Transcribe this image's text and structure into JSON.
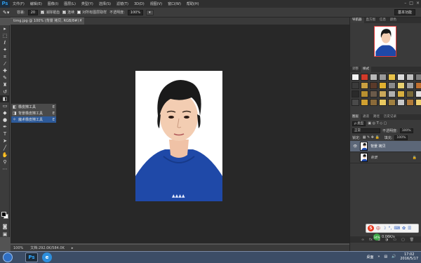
{
  "menubar": {
    "logo": "Ps",
    "items": [
      "文件(F)",
      "编辑(E)",
      "图像(I)",
      "图层(L)",
      "类型(Y)",
      "选择(S)",
      "滤镜(T)",
      "3D(D)",
      "视图(V)",
      "窗口(W)",
      "帮助(H)"
    ],
    "window_buttons": [
      "–",
      "□",
      "×"
    ]
  },
  "options": {
    "tool_icon": "brush-icon",
    "tolerance_label": "容差:",
    "tolerance_value": "20",
    "antialias_label": "消除锯齿",
    "contiguous_label": "连续",
    "all_layers_label": "对所有图层取样",
    "opacity_label": "不透明度:",
    "opacity_value": "100%",
    "workspace": "基本功能"
  },
  "document": {
    "tab_title": "timg.jpg @ 100% (背景 拷贝, RGB/8#) *",
    "close": "×"
  },
  "flyout": {
    "items": [
      {
        "label": "橡皮擦工具",
        "key": "E",
        "selected": false
      },
      {
        "label": "背景橡皮擦工具",
        "key": "E",
        "selected": false
      },
      {
        "label": "魔术橡皮擦工具",
        "key": "E",
        "selected": true
      }
    ]
  },
  "status": {
    "zoom": "100%",
    "doc_size": "文档:292.0K/584.0K"
  },
  "panels": {
    "nav_tabs": [
      "导航器",
      "直方图",
      "信息",
      "颜色"
    ],
    "style_tabs": [
      "调整",
      "样式"
    ],
    "layer_tabs": [
      "图层",
      "通道",
      "路径",
      "历史记录"
    ],
    "filter_label": "ρ 类型",
    "blend_mode": "正常",
    "opacity_label": "不透明度:",
    "opacity_value": "100%",
    "lock_label": "锁定:",
    "fill_label": "填充:",
    "fill_value": "100%",
    "layers": [
      {
        "name": "背景 拷贝",
        "selected": true,
        "locked": false
      },
      {
        "name": "背景",
        "selected": false,
        "locked": true
      }
    ],
    "style_colors": [
      "#f4f4f4",
      "#d23a2a",
      "#b8b8b8",
      "#9a9a9a",
      "#e8c24a",
      "#dcdcdc",
      "#c0c0c0",
      "#7c7c7c",
      "#3a3a3a",
      "#caa040",
      "#5a3a2a",
      "#e0b030",
      "#8a8a8a",
      "#e8d070",
      "#a0a0a0",
      "#c07030",
      "#2a2a2a",
      "#b89030",
      "#6a5a4a",
      "#caa85a",
      "#b0b0b0",
      "#d8b040",
      "#7a6a3a",
      "#e0e0e0",
      "#4a4a4a",
      "#d0a030",
      "#8a6a3a",
      "#e8c860",
      "#a08040",
      "#c8c8c8",
      "#b07a3a",
      "#f0d070"
    ]
  },
  "tray": {
    "ime_letter": "S",
    "ime_text": "中",
    "net_percent": "34%",
    "net_speed": "0.06K/s",
    "desktop": "桌面",
    "time": "17:02",
    "date": "2016/5/17"
  },
  "taskbar": {
    "ps_label": "Ps",
    "ie_label": "e"
  }
}
